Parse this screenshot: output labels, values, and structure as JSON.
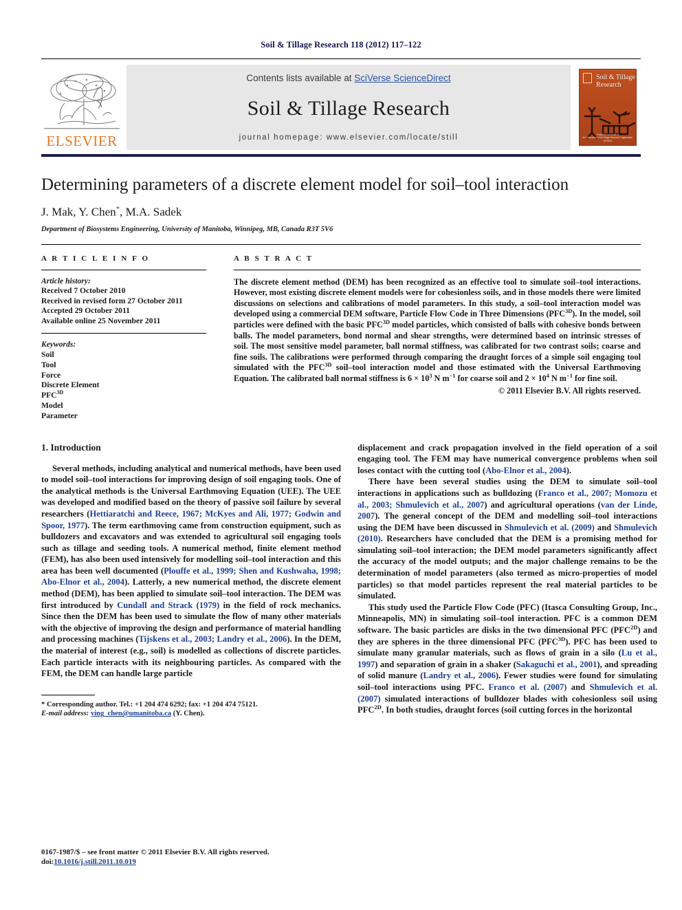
{
  "running_head": "Soil & Tillage Research 118 (2012) 117–122",
  "masthead": {
    "contents_prefix": "Contents lists available at ",
    "contents_link": "SciVerse ScienceDirect",
    "journal_title": "Soil & Tillage Research",
    "homepage": "journal homepage: www.elsevier.com/locate/still",
    "publisher_logo_text": "ELSEVIER",
    "cover_title_line1": "Soil & Tillage",
    "cover_title_line2": "Research",
    "cover_footer_line1": "Published on behalf of",
    "cover_footer_line2": "the International Soil Tillage Research Organization (ISTRO)",
    "accent_orange": "#E87722",
    "accent_blue": "#1c3f94",
    "cover_bg": "#b5491c"
  },
  "article": {
    "title": "Determining parameters of a discrete element model for soil–tool interaction",
    "authors": "J. Mak, Y. Chen",
    "authors_tail": ", M.A. Sadek",
    "corresponding_marker": "*",
    "affiliation": "Department of Biosystems Engineering, University of Manitoba, Winnipeg, MB, Canada R3T 5V6"
  },
  "article_info": {
    "heading": "A R T I C L E  I N F O",
    "history_label": "Article history:",
    "history": [
      "Received 7 October 2010",
      "Received in revised form 27 October 2011",
      "Accepted 29 October 2011",
      "Available online 25 November 2011"
    ],
    "keywords_label": "Keywords:",
    "keywords": [
      "Soil",
      "Tool",
      "Force",
      "Discrete Element",
      "PFC",
      "Model",
      "Parameter"
    ],
    "keyword_pfc_sup": "3D"
  },
  "abstract": {
    "heading": "A B S T R A C T",
    "p1_a": "The discrete element method (DEM) has been recognized as an effective tool to simulate soil–tool interactions. However, most existing discrete element models were for cohesionless soils, and in those models there were limited discussions on selections and calibrations of model parameters. In this study, a soil–tool interaction model was developed using a commercial DEM software, Particle Flow Code in Three Dimensions (PFC",
    "sup1": "3D",
    "p1_b": "). In the model, soil particles were defined with the basic PFC",
    "sup2": "3D",
    "p1_c": " model particles, which consisted of balls with cohesive bonds between balls. The model parameters, bond normal and shear strengths, were determined based on intrinsic stresses of soil. The most sensitive model parameter, ball normal stiffness, was calibrated for two contrast soils; coarse and fine soils. The calibrations were performed through comparing the draught forces of a simple soil engaging tool simulated with the PFC",
    "sup3": "3D",
    "p1_d": " soil–tool interaction model and those estimated with the Universal Earthmoving Equation. The calibrated ball normal stiffness is 6 × 10",
    "sup4": "3",
    "p1_e": " N m",
    "sup5": "−1",
    "p1_f": " for coarse soil and 2 × 10",
    "sup6": "4",
    "p1_g": " N m",
    "sup7": "−1",
    "p1_h": " for fine soil.",
    "copyright": "© 2011 Elsevier B.V. All rights reserved."
  },
  "introduction": {
    "heading": "1.  Introduction",
    "left": {
      "p1_a": "Several methods, including analytical and numerical methods, have been used to model soil–tool interactions for improving design of soil engaging tools. One of the analytical methods is the Universal Earthmoving Equation (UEE). The UEE was developed and modified based on the theory of passive soil failure by several researchers (",
      "p1_ref1": "Hettiaratchi and Reece, 1967; McKyes and Ali, 1977; Godwin and Spoor, 1977",
      "p1_b": "). The term earthmoving came from construction equipment, such as bulldozers and excavators and was extended to agricultural soil engaging tools such as tillage and seeding tools. A numerical method, finite element method (FEM), has also been used intensively for modelling soil–tool interaction and this area has been well documented (",
      "p1_ref2": "Plouffe et al., 1999; Shen and Kushwaha, 1998; Abo-Elnor et al., 2004",
      "p1_c": "). Latterly, a new numerical method, the discrete element method (DEM), has been applied to simulate soil–tool interaction. The DEM was first introduced by ",
      "p1_ref3": "Cundall and Strack (1979)",
      "p1_d": " in the field of rock mechanics. Since then the DEM has been used to simulate the flow of many other materials with the objective of improving the design and performance of material handling and processing machines (",
      "p1_ref4": "Tijskens et al., 2003; Landry et al., 2006",
      "p1_e": "). In the DEM, the material of interest (e.g., soil) is modelled as collections of discrete particles. Each particle interacts with its neighbouring particles. As compared with the FEM, the DEM can handle large particle"
    },
    "right": {
      "p1_a": "displacement and crack propagation involved in the field operation of a soil engaging tool. The FEM may have numerical convergence problems when soil loses contact with the cutting tool (",
      "p1_ref1": "Abo-Elnor et al., 2004",
      "p1_b": ").",
      "p2_a": "There have been several studies using the DEM to simulate soil–tool interactions in applications such as bulldozing (",
      "p2_ref1": "Franco et al., 2007; Momozu et al., 2003; Shmulevich et al., 2007",
      "p2_b": ") and agricultural operations (",
      "p2_ref2": "van der Linde, 2007",
      "p2_c": "). The general concept of the DEM and modelling soil–tool interactions using the DEM have been discussed in ",
      "p2_ref3": "Shmulevich et al. (2009)",
      "p2_d": " and ",
      "p2_ref4": "Shmulevich (2010)",
      "p2_e": ". Researchers have concluded that the DEM is a promising method for simulating soil–tool interaction; the DEM model parameters significantly affect the accuracy of the model outputs; and the major challenge remains to be the determination of model parameters (also termed as micro-properties of model particles) so that model particles represent the real material particles to be simulated.",
      "p3_a": "This study used the Particle Flow Code (PFC) (Itasca Consulting Group, Inc., Minneapolis, MN) in simulating soil–tool interaction. PFC is a common DEM software. The basic particles are disks in the two dimensional PFC (PFC",
      "p3_sup1": "2D",
      "p3_b": ") and they are spheres in the three dimensional PFC (PFC",
      "p3_sup2": "3D",
      "p3_c": "). PFC has been used to simulate many granular materials, such as flows of grain in a silo (",
      "p3_ref1": "Lu et al., 1997",
      "p3_d": ") and separation of grain in a shaker (",
      "p3_ref2": "Sakaguchi et al., 2001",
      "p3_e": "), and spreading of solid manure (",
      "p3_ref3": "Landry et al., 2006",
      "p3_f": "). Fewer studies were found for simulating soil–tool interactions using PFC. ",
      "p3_ref4": "Franco et al. (2007)",
      "p3_g": " and ",
      "p3_ref5": "Shmulevich et al. (2007)",
      "p3_h": " simulated interactions of bulldozer blades with cohesionless soil using PFC",
      "p3_sup3": "2D",
      "p3_i": ". In both studies, draught forces (soil cutting forces in the horizontal"
    }
  },
  "footnote": {
    "corresponding": "* Corresponding author. Tel.: +1 204 474 6292; fax: +1 204 474 75121.",
    "email_label": "E-mail address:",
    "email": "ying_chen@umanitoba.ca",
    "email_tail": " (Y. Chen)."
  },
  "page_footer": {
    "issn_line": "0167-1987/$ – see front matter © 2011 Elsevier B.V. All rights reserved.",
    "doi_label": "doi:",
    "doi": "10.1016/j.still.2011.10.019"
  }
}
